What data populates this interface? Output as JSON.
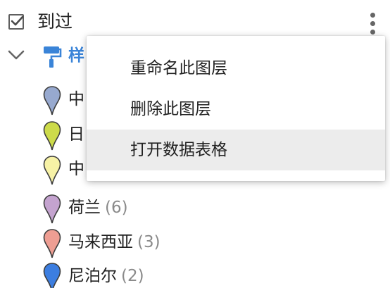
{
  "layer": {
    "title": "到过",
    "checked": true,
    "style_label": "样"
  },
  "legend": [
    {
      "label": "中",
      "count": "",
      "color": "#97a9cf"
    },
    {
      "label": "日",
      "count": "",
      "color": "#cddb4a"
    },
    {
      "label": "中",
      "count": "",
      "color": "#f7f2a6"
    },
    {
      "label": "荷兰",
      "count": "(6)",
      "color": "#c4a3cf"
    },
    {
      "label": "马来西亚",
      "count": "(3)",
      "color": "#ee9e93"
    },
    {
      "label": "尼泊尔",
      "count": "(2)",
      "color": "#3c7ee0"
    }
  ],
  "menu": {
    "items": [
      {
        "label": "重命名此图层",
        "highlighted": false
      },
      {
        "label": "删除此图层",
        "highlighted": false
      },
      {
        "label": "打开数据表格",
        "highlighted": true
      }
    ]
  },
  "icons": {
    "checkbox": "checkbox-checked-icon",
    "more": "more-vertical-icon",
    "collapse": "chevron-down-icon",
    "style": "paint-roller-icon",
    "pin": "map-pin-icon"
  },
  "colors": {
    "accent": "#3a84d8",
    "menu_highlight": "#ececec",
    "count_text": "#8a8a8a"
  }
}
